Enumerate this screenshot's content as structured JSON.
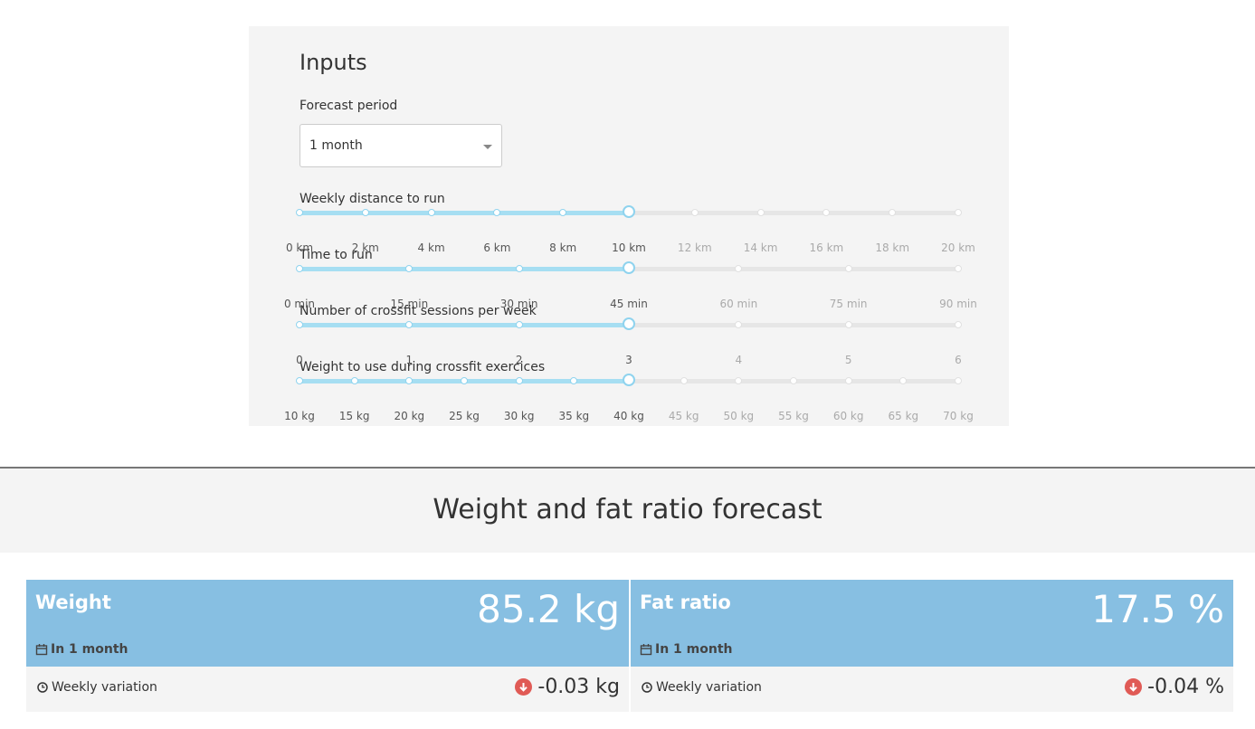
{
  "inputs": {
    "title": "Inputs",
    "forecast_period": {
      "label": "Forecast period",
      "selected": "1 month"
    },
    "sliders": [
      {
        "label": "Weekly distance to run",
        "ticks": [
          "0 km",
          "2 km",
          "4 km",
          "6 km",
          "8 km",
          "10 km",
          "12 km",
          "14 km",
          "16 km",
          "18 km",
          "20 km"
        ],
        "value_index": 5
      },
      {
        "label": "Time to run",
        "ticks": [
          "0 min",
          "15 min",
          "30 min",
          "45 min",
          "60 min",
          "75 min",
          "90 min"
        ],
        "value_index": 3
      },
      {
        "label": "Number of crossfit sessions per week",
        "ticks": [
          "0",
          "1",
          "2",
          "3",
          "4",
          "5",
          "6"
        ],
        "value_index": 3
      },
      {
        "label": "Weight to use during crossfit exercices",
        "ticks": [
          "10 kg",
          "15 kg",
          "20 kg",
          "25 kg",
          "30 kg",
          "35 kg",
          "40 kg",
          "45 kg",
          "50 kg",
          "55 kg",
          "60 kg",
          "65 kg",
          "70 kg"
        ],
        "value_index": 6
      }
    ]
  },
  "forecast": {
    "title": "Weight and fat ratio forecast",
    "cards": [
      {
        "name": "Weight",
        "value": "85.2 kg",
        "period": "In 1 month",
        "variation_label": "Weekly variation",
        "variation_value": "-0.03 kg"
      },
      {
        "name": "Fat ratio",
        "value": "17.5 %",
        "period": "In 1 month",
        "variation_label": "Weekly variation",
        "variation_value": "-0.04 %"
      }
    ]
  },
  "colors": {
    "accent": "#87bfe2",
    "slider_fill": "#a6def2",
    "down": "#e05a55",
    "panel": "#f4f4f4"
  },
  "icons": {
    "period": "calendar-icon",
    "variation": "clock-icon",
    "trend": "arrow-down-circle-icon",
    "select": "chevron-down-icon"
  }
}
